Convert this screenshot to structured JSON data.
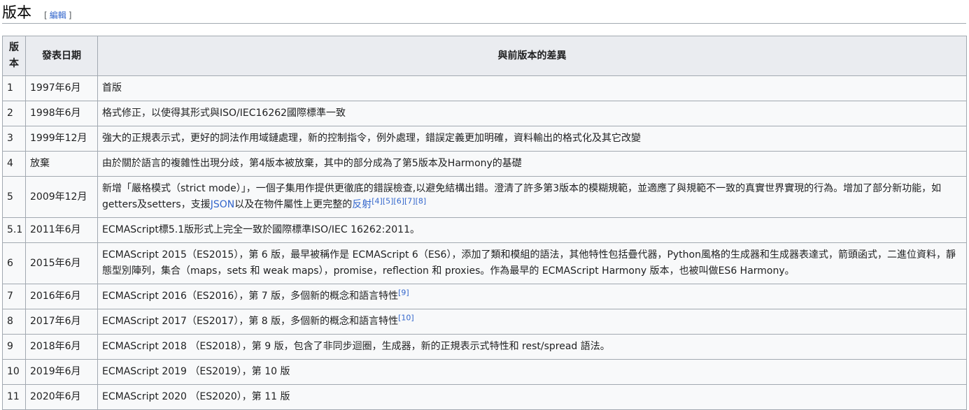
{
  "section": {
    "title": "版本",
    "edit_open": "[",
    "edit_label": "編輯",
    "edit_close": "]"
  },
  "table": {
    "headers": {
      "version": "版本",
      "date": "發表日期",
      "diff": "與前版本的差異"
    },
    "rows": [
      {
        "version": "1",
        "date": "1997年6月",
        "diff": "首版"
      },
      {
        "version": "2",
        "date": "1998年6月",
        "diff": "格式修正，以使得其形式與ISO/IEC16262國際標準一致"
      },
      {
        "version": "3",
        "date": "1999年12月",
        "diff": "強大的正規表示式，更好的詞法作用域鏈處理，新的控制指令，例外處理，錯誤定義更加明確，資料輸出的格式化及其它改變"
      },
      {
        "version": "4",
        "date": "放棄",
        "diff": "由於關於語言的複雜性出現分歧，第4版本被放棄，其中的部分成為了第5版本及Harmony的基礎"
      },
      {
        "version": "5",
        "date": "2009年12月",
        "diff_a": "新增「嚴格模式（strict mode）」，一個子集用作提供更徹底的錯誤檢查,以避免結構出錯。澄清了許多第3版本的模糊規範，並適應了與規範不一致的真實世界實現的行為。增加了部分新功能，如getters及setters，支援",
        "diff_link1": "JSON",
        "diff_b": "以及在物件屬性上更完整的",
        "diff_link2": "反射",
        "refs": [
          "[4]",
          "[5]",
          "[6]",
          "[7]",
          "[8]"
        ]
      },
      {
        "version": "5.1",
        "date": "2011年6月",
        "diff": "ECMAScript標5.1版形式上完全一致於國際標準ISO/IEC 16262:2011。"
      },
      {
        "version": "6",
        "date": "2015年6月",
        "diff": "ECMAScript 2015（ES2015），第 6 版，最早被稱作是 ECMAScript 6（ES6），添加了類和模組的語法，其他特性包括疊代器，Python風格的生成器和生成器表達式，箭頭函式，二進位資料，靜態型別陣列，集合（maps，sets 和 weak maps），promise，reflection 和 proxies。作為最早的 ECMAScript Harmony 版本，也被叫做ES6 Harmony。"
      },
      {
        "version": "7",
        "date": "2016年6月",
        "diff": "ECMAScript 2016（ES2016），第 7 版，多個新的概念和語言特性",
        "ref": "[9]"
      },
      {
        "version": "8",
        "date": "2017年6月",
        "diff": "ECMAScript 2017（ES2017），第 8 版，多個新的概念和語言特性",
        "ref": "[10]"
      },
      {
        "version": "9",
        "date": "2018年6月",
        "diff": "ECMAScript 2018 （ES2018），第 9 版，包含了非同步迴圈，生成器，新的正規表示式特性和 rest/spread 語法。"
      },
      {
        "version": "10",
        "date": "2019年6月",
        "diff": "ECMAScript 2019 （ES2019），第 10 版"
      },
      {
        "version": "11",
        "date": "2020年6月",
        "diff": "ECMAScript 2020 （ES2020），第 11 版"
      }
    ]
  },
  "colors": {
    "link": "#3366cc",
    "border": "#a2a9b1",
    "header_bg": "#eaecf0",
    "cell_bg": "#f8f9fa"
  }
}
